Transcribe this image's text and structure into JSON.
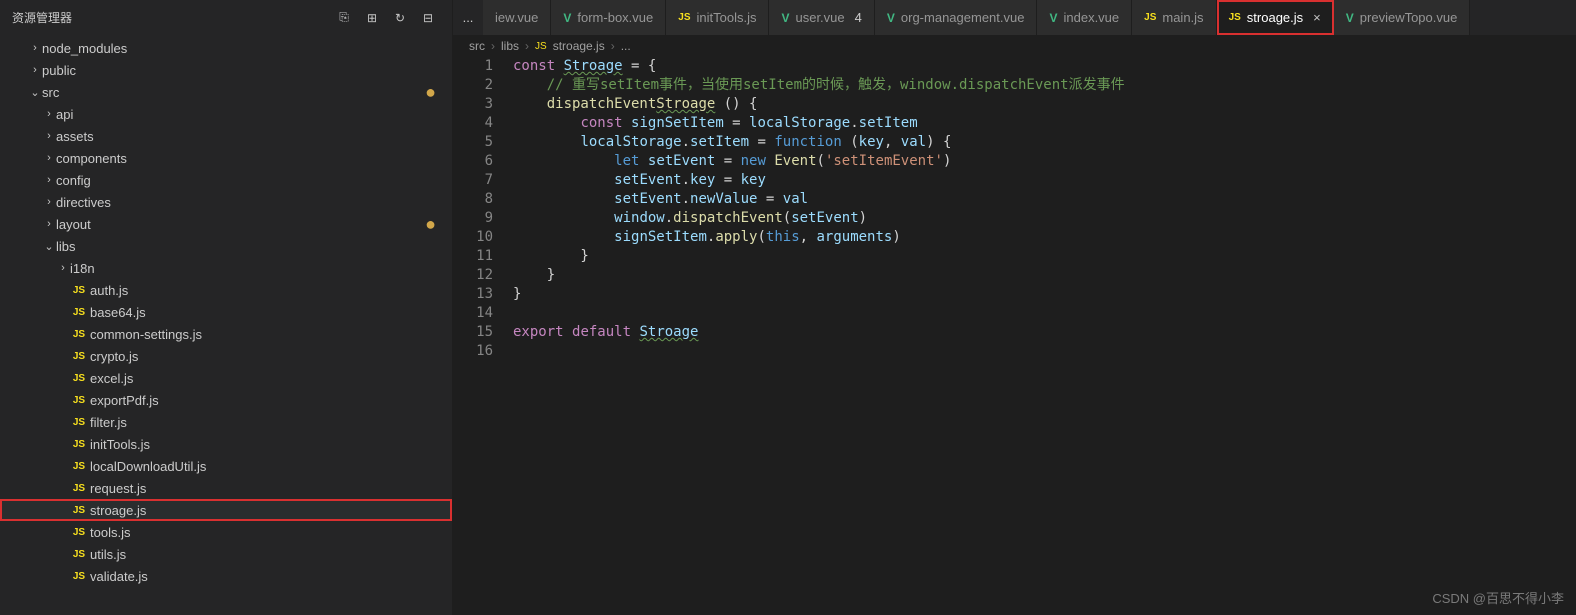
{
  "sidebar": {
    "title": "资源管理器",
    "tree": [
      {
        "type": "folder",
        "label": "node_modules",
        "chev": "›",
        "indent": 1
      },
      {
        "type": "folder",
        "label": "public",
        "chev": "›",
        "indent": 1
      },
      {
        "type": "folder",
        "label": "src",
        "chev": "⌄",
        "indent": 1,
        "modified": true
      },
      {
        "type": "folder",
        "label": "api",
        "chev": "›",
        "indent": 2
      },
      {
        "type": "folder",
        "label": "assets",
        "chev": "›",
        "indent": 2
      },
      {
        "type": "folder",
        "label": "components",
        "chev": "›",
        "indent": 2
      },
      {
        "type": "folder",
        "label": "config",
        "chev": "›",
        "indent": 2
      },
      {
        "type": "folder",
        "label": "directives",
        "chev": "›",
        "indent": 2
      },
      {
        "type": "folder",
        "label": "layout",
        "chev": "›",
        "indent": 2,
        "modified": true
      },
      {
        "type": "folder",
        "label": "libs",
        "chev": "⌄",
        "indent": 2
      },
      {
        "type": "folder",
        "label": "i18n",
        "chev": "›",
        "indent": 3
      },
      {
        "type": "file",
        "label": "auth.js",
        "icon": "JS",
        "indent": 3
      },
      {
        "type": "file",
        "label": "base64.js",
        "icon": "JS",
        "indent": 3
      },
      {
        "type": "file",
        "label": "common-settings.js",
        "icon": "JS",
        "indent": 3
      },
      {
        "type": "file",
        "label": "crypto.js",
        "icon": "JS",
        "indent": 3
      },
      {
        "type": "file",
        "label": "excel.js",
        "icon": "JS",
        "indent": 3
      },
      {
        "type": "file",
        "label": "exportPdf.js",
        "icon": "JS",
        "indent": 3
      },
      {
        "type": "file",
        "label": "filter.js",
        "icon": "JS",
        "indent": 3
      },
      {
        "type": "file",
        "label": "initTools.js",
        "icon": "JS",
        "indent": 3
      },
      {
        "type": "file",
        "label": "localDownloadUtil.js",
        "icon": "JS",
        "indent": 3
      },
      {
        "type": "file",
        "label": "request.js",
        "icon": "JS",
        "indent": 3
      },
      {
        "type": "file",
        "label": "stroage.js",
        "icon": "JS",
        "indent": 3,
        "highlight": true
      },
      {
        "type": "file",
        "label": "tools.js",
        "icon": "JS",
        "indent": 3
      },
      {
        "type": "file",
        "label": "utils.js",
        "icon": "JS",
        "indent": 3
      },
      {
        "type": "file",
        "label": "validate.js",
        "icon": "JS",
        "indent": 3
      }
    ]
  },
  "tabs": {
    "more": "...",
    "items": [
      {
        "label": "iew.vue",
        "icon": "",
        "type": "partial"
      },
      {
        "label": "form-box.vue",
        "icon": "V",
        "type": "vue"
      },
      {
        "label": "initTools.js",
        "icon": "JS",
        "type": "js"
      },
      {
        "label": "user.vue",
        "icon": "V",
        "type": "vue",
        "badge": "4"
      },
      {
        "label": "org-management.vue",
        "icon": "V",
        "type": "vue"
      },
      {
        "label": "index.vue",
        "icon": "V",
        "type": "vue"
      },
      {
        "label": "main.js",
        "icon": "JS",
        "type": "js"
      },
      {
        "label": "stroage.js",
        "icon": "JS",
        "type": "js",
        "active": true,
        "close": true,
        "highlight": true
      },
      {
        "label": "previewTopo.vue",
        "icon": "V",
        "type": "vue"
      }
    ]
  },
  "breadcrumb": [
    "src",
    "libs",
    "stroage.js",
    "..."
  ],
  "breadcrumb_icon": "JS",
  "code_lines": [
    "1",
    "2",
    "3",
    "4",
    "5",
    "6",
    "7",
    "8",
    "9",
    "10",
    "11",
    "12",
    "13",
    "14",
    "15",
    "16"
  ],
  "watermark": "CSDN @百思不得小李"
}
